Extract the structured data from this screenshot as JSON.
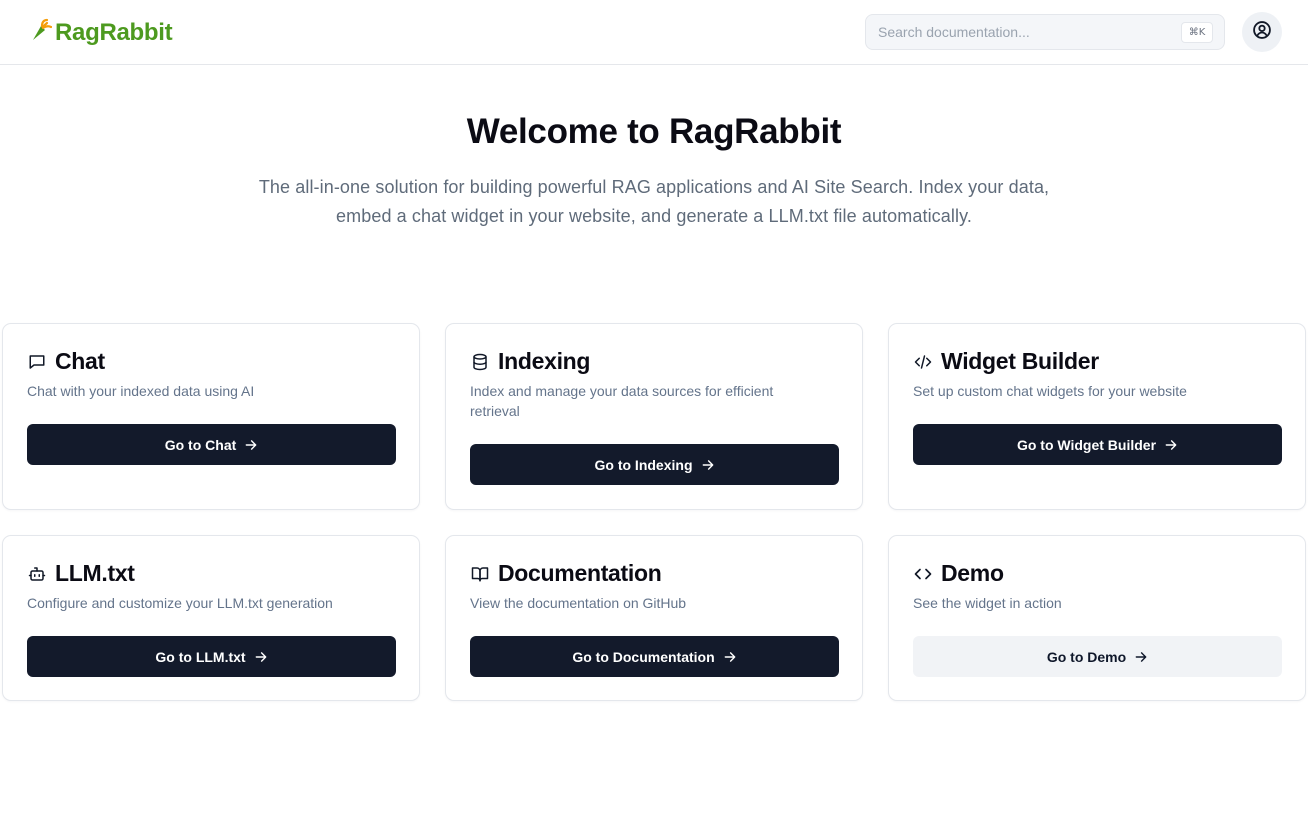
{
  "header": {
    "logo_text": "RagRabbit",
    "search_placeholder": "Search documentation...",
    "search_shortcut": "⌘K"
  },
  "hero": {
    "title": "Welcome to RagRabbit",
    "subtitle": "The all-in-one solution for building powerful RAG applications and AI Site Search. Index your data, embed a chat widget in your website, and generate a LLM.txt file automatically."
  },
  "cards": [
    {
      "icon": "message-square-icon",
      "title": "Chat",
      "description": "Chat with your indexed data using AI",
      "button": "Go to Chat"
    },
    {
      "icon": "database-icon",
      "title": "Indexing",
      "description": "Index and manage your data sources for efficient retrieval",
      "button": "Go to Indexing"
    },
    {
      "icon": "code-xml-icon",
      "title": "Widget Builder",
      "description": "Set up custom chat widgets for your website",
      "button": "Go to Widget Builder"
    },
    {
      "icon": "bot-icon",
      "title": "LLM.txt",
      "description": "Configure and customize your LLM.txt generation",
      "button": "Go to LLM.txt"
    },
    {
      "icon": "book-open-icon",
      "title": "Documentation",
      "description": "View the documentation on GitHub",
      "button": "Go to Documentation"
    },
    {
      "icon": "code-icon",
      "title": "Demo",
      "description": "See the widget in action",
      "button": "Go to Demo"
    }
  ],
  "colors": {
    "brand": "#4d9a1f",
    "primary_button": "#131a2b",
    "secondary_button": "#f1f3f6",
    "muted_text": "#64748b"
  }
}
